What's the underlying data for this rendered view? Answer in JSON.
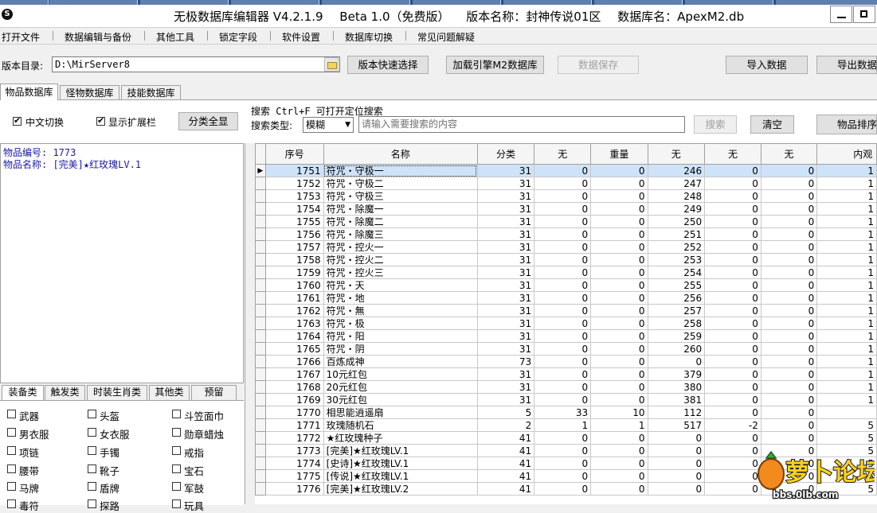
{
  "title": {
    "app": "无极数据库编辑器 V4.2.1.9",
    "edition": "Beta 1.0（免费版）",
    "version_name": "版本名称：封神传说01区",
    "db_name": "数据库名：ApexM2.db"
  },
  "menu": [
    "打开文件",
    "数据编辑与备份",
    "其他工具",
    "锁定字段",
    "软件设置",
    "数据库切换",
    "常见问题解疑"
  ],
  "toolbar": {
    "dir_label": "版本目录:",
    "dir_value": "D:\\MirServer8",
    "quick_select": "版本快速选择",
    "load_db": "加载引擎M2数据库",
    "save_data": "数据保存",
    "import_data": "导入数据",
    "export_data": "导出数据"
  },
  "tabs": [
    "物品数据库",
    "怪物数据库",
    "技能数据库"
  ],
  "options": {
    "chinese_switch": "中文切换",
    "show_ext": "显示扩展栏",
    "show_all": "分类全显"
  },
  "search": {
    "title": "搜索  Ctrl+F 可打开定位搜索",
    "type_label": "搜索类型:",
    "type_value": "模糊",
    "placeholder": "请输入需要搜索的内容",
    "search_btn": "搜索",
    "clear_btn": "清空",
    "sort_btn": "物品排序"
  },
  "info": {
    "line1": "物品编号: 1773",
    "line2": "物品名称: [完美]★红玫瑰LV.1"
  },
  "cat_tabs": [
    "装备类",
    "触发类",
    "时装生肖类",
    "其他类",
    "预留"
  ],
  "categories": [
    "武器",
    "头盔",
    "斗笠面巾",
    "男衣服",
    "女衣服",
    "勋章蜡烛",
    "项链",
    "手镯",
    "戒指",
    "腰带",
    "靴子",
    "宝石",
    "马牌",
    "盾牌",
    "军鼓",
    "毒符",
    "探路",
    "玩具"
  ],
  "columns": [
    "序号",
    "名称",
    "分类",
    "无",
    "重量",
    "无",
    "无",
    "无",
    "内观"
  ],
  "rows": [
    [
      "1751",
      "符咒・守极一",
      "31",
      "0",
      "0",
      "246",
      "0",
      "0",
      "1"
    ],
    [
      "1752",
      "符咒・守极二",
      "31",
      "0",
      "0",
      "247",
      "0",
      "0",
      "1"
    ],
    [
      "1753",
      "符咒・守极三",
      "31",
      "0",
      "0",
      "248",
      "0",
      "0",
      "1"
    ],
    [
      "1754",
      "符咒・除魔一",
      "31",
      "0",
      "0",
      "249",
      "0",
      "0",
      "1"
    ],
    [
      "1755",
      "符咒・除魔二",
      "31",
      "0",
      "0",
      "250",
      "0",
      "0",
      "1"
    ],
    [
      "1756",
      "符咒・除魔三",
      "31",
      "0",
      "0",
      "251",
      "0",
      "0",
      "1"
    ],
    [
      "1757",
      "符咒・控火一",
      "31",
      "0",
      "0",
      "252",
      "0",
      "0",
      "1"
    ],
    [
      "1758",
      "符咒・控火二",
      "31",
      "0",
      "0",
      "253",
      "0",
      "0",
      "1"
    ],
    [
      "1759",
      "符咒・控火三",
      "31",
      "0",
      "0",
      "254",
      "0",
      "0",
      "1"
    ],
    [
      "1760",
      "符咒・天",
      "31",
      "0",
      "0",
      "255",
      "0",
      "0",
      "1"
    ],
    [
      "1761",
      "符咒・地",
      "31",
      "0",
      "0",
      "256",
      "0",
      "0",
      "1"
    ],
    [
      "1762",
      "符咒・無",
      "31",
      "0",
      "0",
      "257",
      "0",
      "0",
      "1"
    ],
    [
      "1763",
      "符咒・极",
      "31",
      "0",
      "0",
      "258",
      "0",
      "0",
      "1"
    ],
    [
      "1764",
      "符咒・阳",
      "31",
      "0",
      "0",
      "259",
      "0",
      "0",
      "1"
    ],
    [
      "1765",
      "符咒・阴",
      "31",
      "0",
      "0",
      "260",
      "0",
      "0",
      "1"
    ],
    [
      "1766",
      "百炼成神",
      "73",
      "0",
      "0",
      "0",
      "0",
      "0",
      "1"
    ],
    [
      "1767",
      "10元红包",
      "31",
      "0",
      "0",
      "379",
      "0",
      "0",
      "1"
    ],
    [
      "1768",
      "20元红包",
      "31",
      "0",
      "0",
      "380",
      "0",
      "0",
      "1"
    ],
    [
      "1769",
      "30元红包",
      "31",
      "0",
      "0",
      "381",
      "0",
      "0",
      "1"
    ],
    [
      "1770",
      "相思能逍遥扇",
      "5",
      "33",
      "10",
      "112",
      "0",
      "0",
      ""
    ],
    [
      "1771",
      "玫瑰随机石",
      "2",
      "1",
      "1",
      "517",
      "-2",
      "0",
      "5"
    ],
    [
      "1772",
      "★红玫瑰种子",
      "41",
      "0",
      "0",
      "0",
      "0",
      "0",
      "5"
    ],
    [
      "1773",
      "[完美]★红玫瑰LV.1",
      "41",
      "0",
      "0",
      "0",
      "0",
      "0",
      "5"
    ],
    [
      "1774",
      "[史诗]★红玫瑰LV.1",
      "41",
      "0",
      "0",
      "0",
      "0",
      "0",
      "5"
    ],
    [
      "1775",
      "[传说]★红玫瑰LV.1",
      "41",
      "0",
      "0",
      "0",
      "0",
      "0",
      "5"
    ],
    [
      "1776",
      "[完美]★红玫瑰LV.2",
      "41",
      "0",
      "0",
      "0",
      "0",
      "0",
      "5"
    ]
  ],
  "watermark": {
    "big": "萝卜论坛",
    "url": "bbs.0lb.com"
  }
}
